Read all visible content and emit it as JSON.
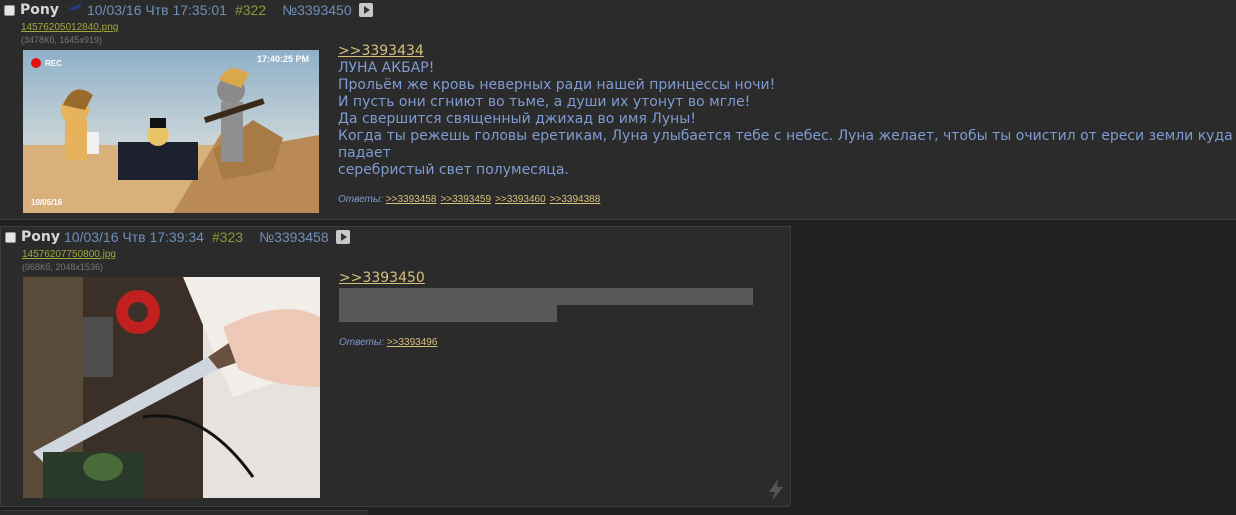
{
  "posts": [
    {
      "name": "Pony",
      "date": "10/03/16 Чтв 17:35:01",
      "number": "#322",
      "id": "№3393450",
      "file": {
        "name": "14576205012840.png",
        "meta": "(3478Кб, 1645x919)"
      },
      "image": {
        "rec": "REC",
        "time": "17:40:25 PM",
        "date": "10/05/16"
      },
      "reply_to": ">>3393434",
      "lines": [
        "ЛУНА АКБАР!",
        "Прольём же кровь неверных ради нашей принцессы ночи!",
        "И пусть они сгниют во тьме, а души их утонут во мгле!",
        "Да свершится священный джихад во имя Луны!",
        "Когда ты режешь головы еретикам, Луна улыбается тебе с небес. Луна желает, чтобы ты очистил от ереси земли куда падает",
        "серебристый свет полумесяца."
      ],
      "replies_label": "Ответы:",
      "replies": [
        ">>3393458",
        ">>3393459",
        ">>3393460",
        ">>3394388"
      ]
    },
    {
      "name": "Pony",
      "date": "10/03/16 Чтв 17:39:34",
      "number": "#323",
      "id": "№3393458",
      "file": {
        "name": "14576207750800.jpg",
        "meta": "(968Кб, 2048x1536)"
      },
      "reply_to": ">>3393450",
      "replies_label": "Ответы:",
      "replies": [
        ">>3393496"
      ]
    }
  ]
}
